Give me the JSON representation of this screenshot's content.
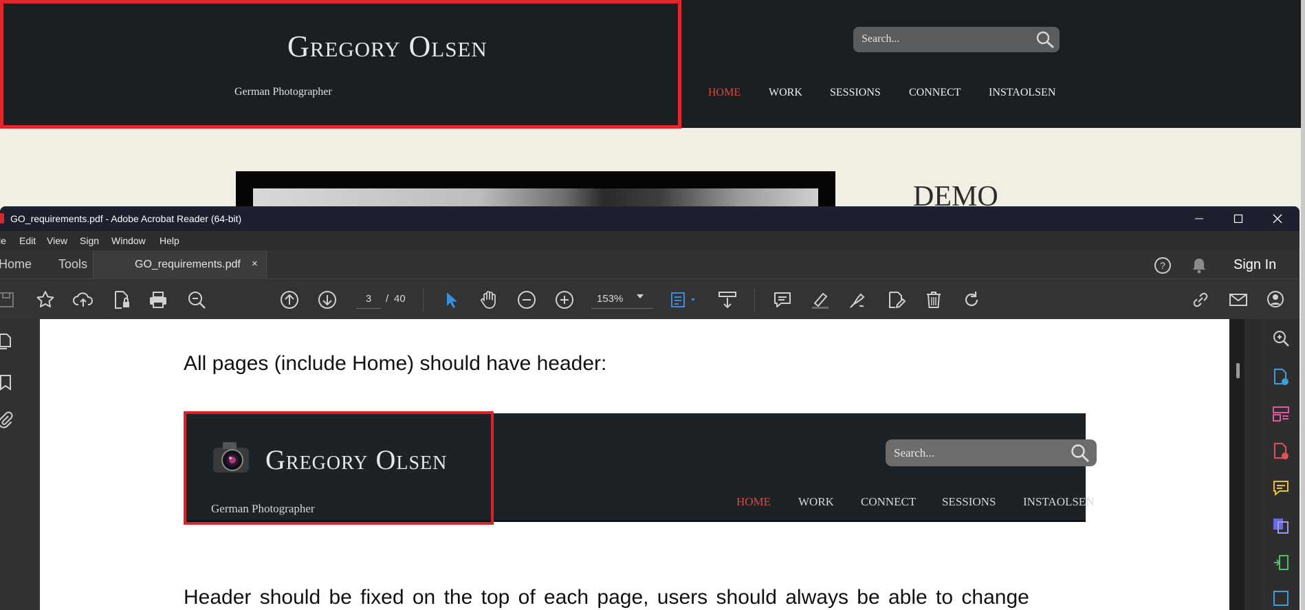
{
  "website": {
    "title": "Gregory Olsen",
    "subtitle": "German Photographer",
    "search_placeholder": "Search...",
    "nav": [
      "HOME",
      "WORK",
      "SESSIONS",
      "CONNECT",
      "INSTAOLSEN"
    ],
    "active_nav": "HOME",
    "side_heading": "DEMO"
  },
  "acrobat": {
    "window_title": "GO_requirements.pdf - Adobe Acrobat Reader (64-bit)",
    "menu": [
      "le",
      "Edit",
      "View",
      "Sign",
      "Window",
      "Help"
    ],
    "tabs": {
      "home": "Home",
      "tools": "Tools",
      "document": "GO_requirements.pdf",
      "close": "×"
    },
    "sign_in": "Sign In",
    "page_current": "3",
    "page_separator": "/",
    "page_total": "40",
    "zoom": "153%",
    "window_buttons": {
      "minimize": "—",
      "maximize": "☐",
      "close": "✕"
    }
  },
  "pdf": {
    "line1": "All pages (include Home) should have header:",
    "header_title": "Gregory Olsen",
    "header_subtitle": "German Photographer",
    "header_search": "Search...",
    "header_nav": [
      "HOME",
      "WORK",
      "CONNECT",
      "SESSIONS",
      "INSTAOLSEN"
    ],
    "line2": "Header should be fixed on the top of each page, users should always be able to change"
  },
  "colors": {
    "highlight_red": "#e3262b",
    "nav_active": "#e0473f",
    "accent_blue": "#3b8de0"
  }
}
